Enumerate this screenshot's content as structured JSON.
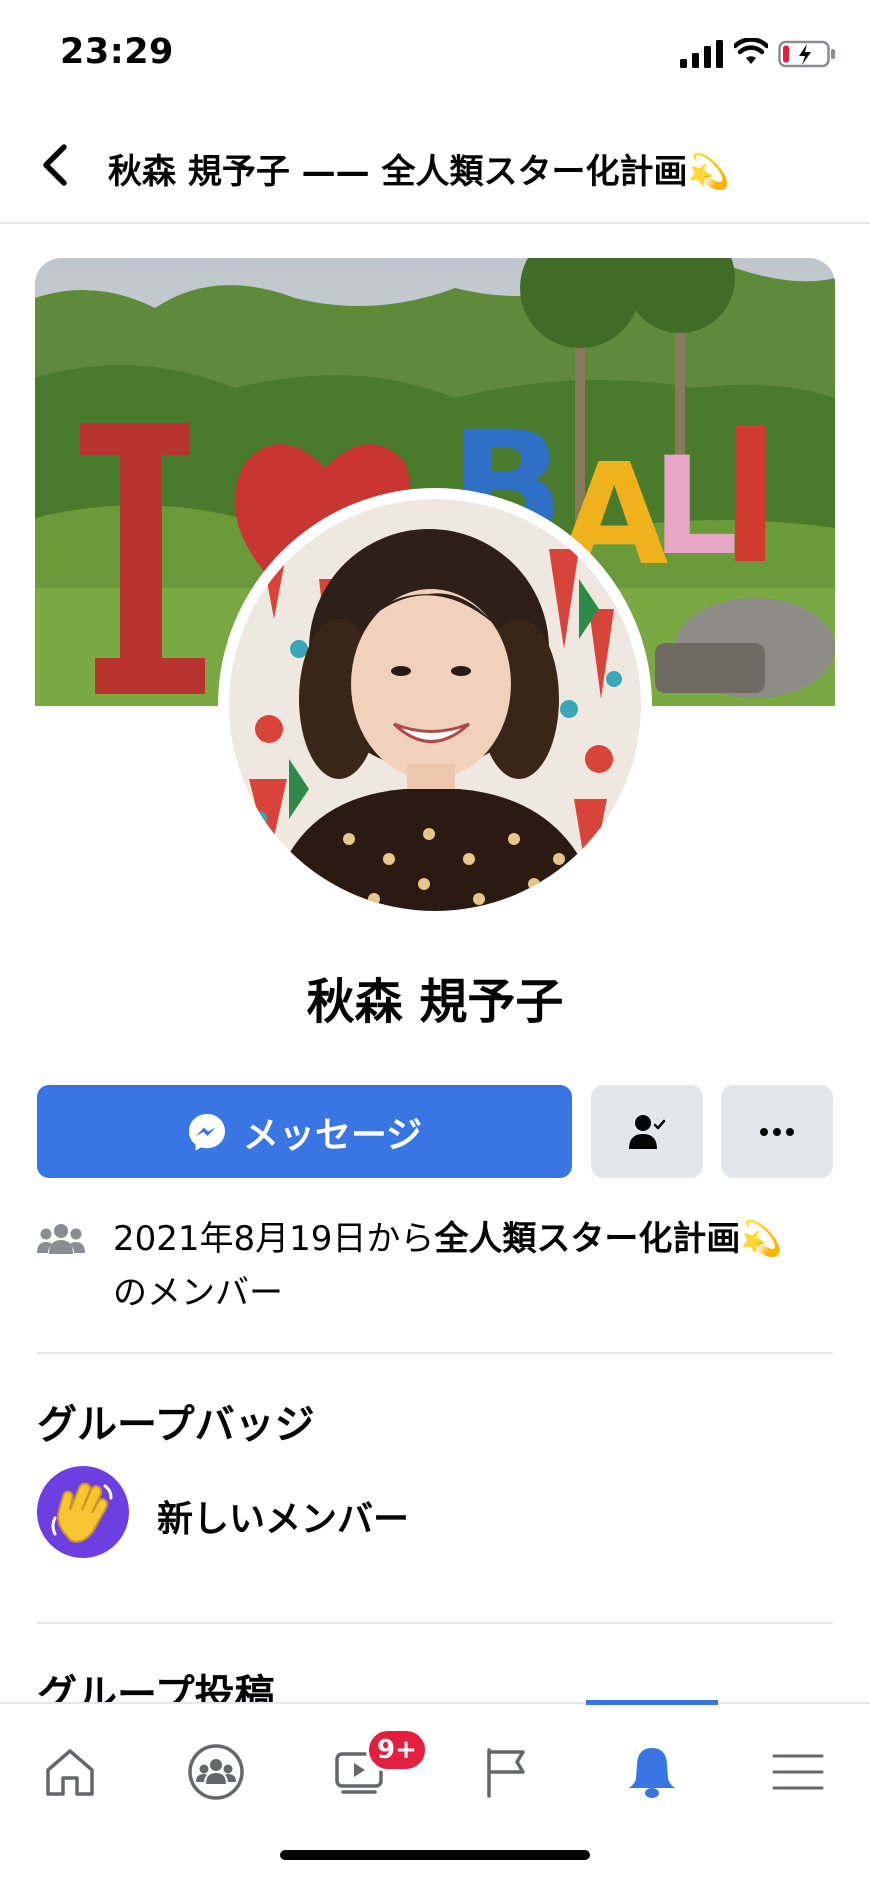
{
  "status_bar": {
    "time": "23:29"
  },
  "header": {
    "title": "秋森 規予子 —— 全人類スター化計画💫"
  },
  "profile": {
    "name": "秋森 規予子"
  },
  "actions": {
    "message_label": "メッセージ"
  },
  "membership": {
    "text_prefix": "2021年8月19日から",
    "group_name": "全人類スター化計画💫",
    "text_suffix": "のメンバー"
  },
  "badges": {
    "section_title": "グループバッジ",
    "items": [
      {
        "label": "新しいメンバー",
        "icon": "waving-hand-icon"
      }
    ]
  },
  "posts": {
    "section_title": "グループ投稿"
  },
  "tab_bar": {
    "tabs": [
      "home",
      "groups",
      "watch",
      "pages",
      "notifications",
      "menu"
    ],
    "active_tab": "notifications",
    "watch_badge": "9+"
  },
  "colors": {
    "accent": "#3a76e3",
    "button_gray": "#e4e6eb",
    "badge_red": "#e41e3f",
    "badge_purple": "#6e3fe0"
  }
}
